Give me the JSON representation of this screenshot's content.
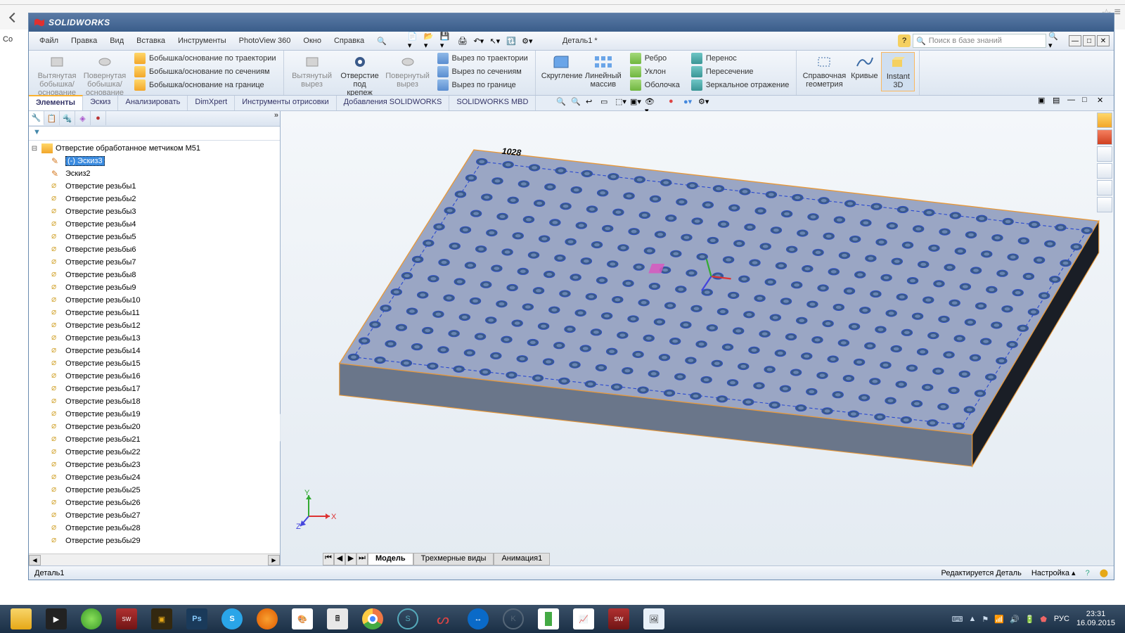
{
  "browser": {
    "bookmark_fragment": "Co"
  },
  "titlebar": {
    "product": "SOLIDWORKS"
  },
  "menu": {
    "items": [
      "Файл",
      "Правка",
      "Вид",
      "Вставка",
      "Инструменты",
      "PhotoView 360",
      "Окно",
      "Справка"
    ],
    "doc_name": "Деталь1 *",
    "search_placeholder": "Поиск в базе знаний"
  },
  "ribbon": {
    "g1_large": [
      {
        "l1": "Вытянутая",
        "l2": "бобышка/основание"
      },
      {
        "l1": "Повернутая",
        "l2": "бобышка/основание"
      }
    ],
    "g1_small": [
      "Бобышка/основание по траектории",
      "Бобышка/основание по сечениям",
      "Бобышка/основание на границе"
    ],
    "g2_large": [
      {
        "l1": "Вытянутый",
        "l2": "вырез"
      },
      {
        "l1": "Отверстие",
        "l2": "под",
        "l3": "крепеж"
      },
      {
        "l1": "Повернутый",
        "l2": "вырез"
      }
    ],
    "g2_small": [
      "Вырез по траектории",
      "Вырез по сечениям",
      "Вырез по границе"
    ],
    "g3_large": [
      {
        "l1": "Скругление"
      },
      {
        "l1": "Линейный",
        "l2": "массив"
      }
    ],
    "g3_small": [
      "Ребро",
      "Уклон",
      "Оболочка"
    ],
    "g4_small": [
      "Перенос",
      "Пересечение",
      "Зеркальное отражение"
    ],
    "g5_large": [
      {
        "l1": "Справочная",
        "l2": "геометрия"
      },
      {
        "l1": "Кривые"
      },
      {
        "l1": "Instant",
        "l2": "3D"
      }
    ]
  },
  "ribbonTabs": [
    "Элементы",
    "Эскиз",
    "Анализировать",
    "DimXpert",
    "Инструменты отрисовки",
    "Добавления SOLIDWORKS",
    "SOLIDWORKS MBD"
  ],
  "featureTree": {
    "root": "Отверстие обработанное метчиком M51",
    "sketch_sel": "(-) Эскиз3",
    "sketch2": "Эскиз2",
    "hole_prefix": "Отверстие резьбы",
    "hole_count": 29
  },
  "vpTabs": {
    "model": "Модель",
    "views3d": "Трехмерные виды",
    "anim": "Анимация1"
  },
  "status": {
    "left": "Деталь1",
    "edit": "Редактируется Деталь",
    "setup": "Настройка"
  },
  "triad": {
    "x": "X",
    "y": "Y",
    "z": "Z"
  },
  "dim_label": "1028",
  "tray": {
    "lang": "РУС",
    "time": "23:31",
    "date": "16.09.2015"
  }
}
